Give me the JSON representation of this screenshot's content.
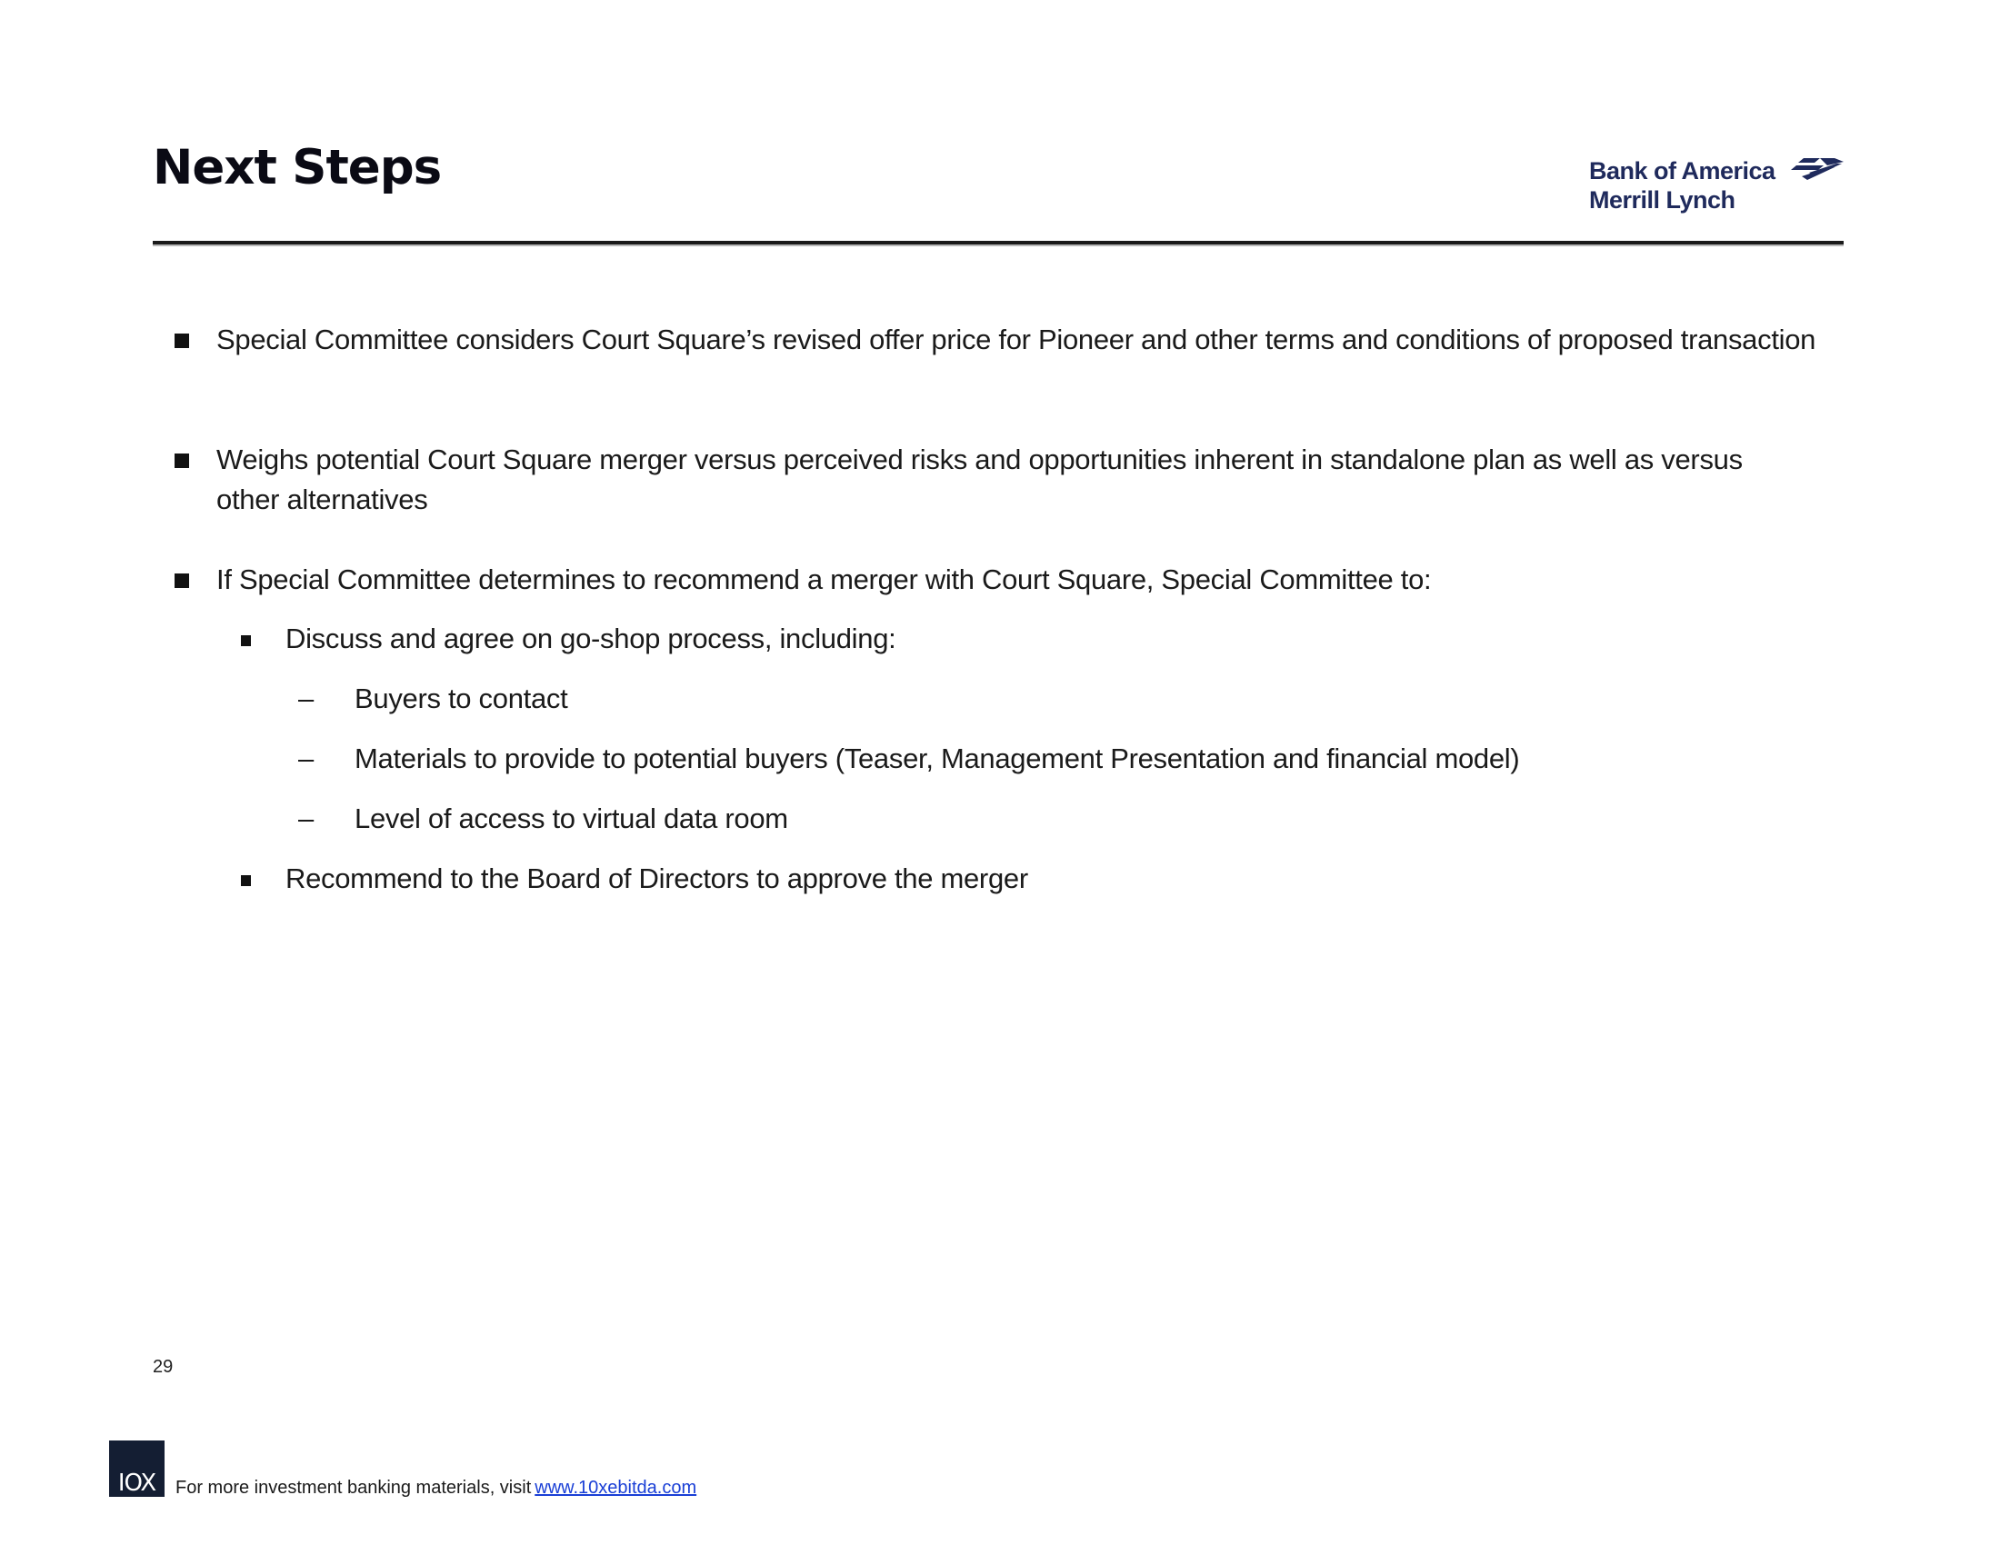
{
  "header": {
    "title": "Next Steps",
    "logo": {
      "line1": "Bank of America",
      "line2": "Merrill Lynch",
      "icon": "flag-icon",
      "color": "#1f2a5c"
    }
  },
  "bullets": [
    {
      "level": 1,
      "text": "Special Committee considers Court Square’s revised offer price for Pioneer and other terms and conditions of proposed transaction"
    },
    {
      "level": 1,
      "text": "Weighs potential Court Square merger versus perceived risks and opportunities inherent in standalone plan as well as versus other alternatives"
    },
    {
      "level": 1,
      "text": "If Special Committee determines to recommend a merger with Court Square, Special Committee to:"
    },
    {
      "level": 2,
      "text": "Discuss and agree on go-shop process, including:"
    },
    {
      "level": 3,
      "marker": "–",
      "text": "Buyers to contact"
    },
    {
      "level": 3,
      "marker": "–",
      "text": "Materials to provide to potential buyers (Teaser, Management Presentation and financial model)"
    },
    {
      "level": 3,
      "marker": "–",
      "text": "Level of access to virtual data room"
    },
    {
      "level": 2,
      "text": "Recommend to the Board of Directors to approve the merger"
    }
  ],
  "page_number": "29",
  "footer": {
    "logo_text": "IOX",
    "text": "For more investment banking materials, visit",
    "link_text": "www.10xebitda.com",
    "link_color": "#1a3fd6"
  }
}
